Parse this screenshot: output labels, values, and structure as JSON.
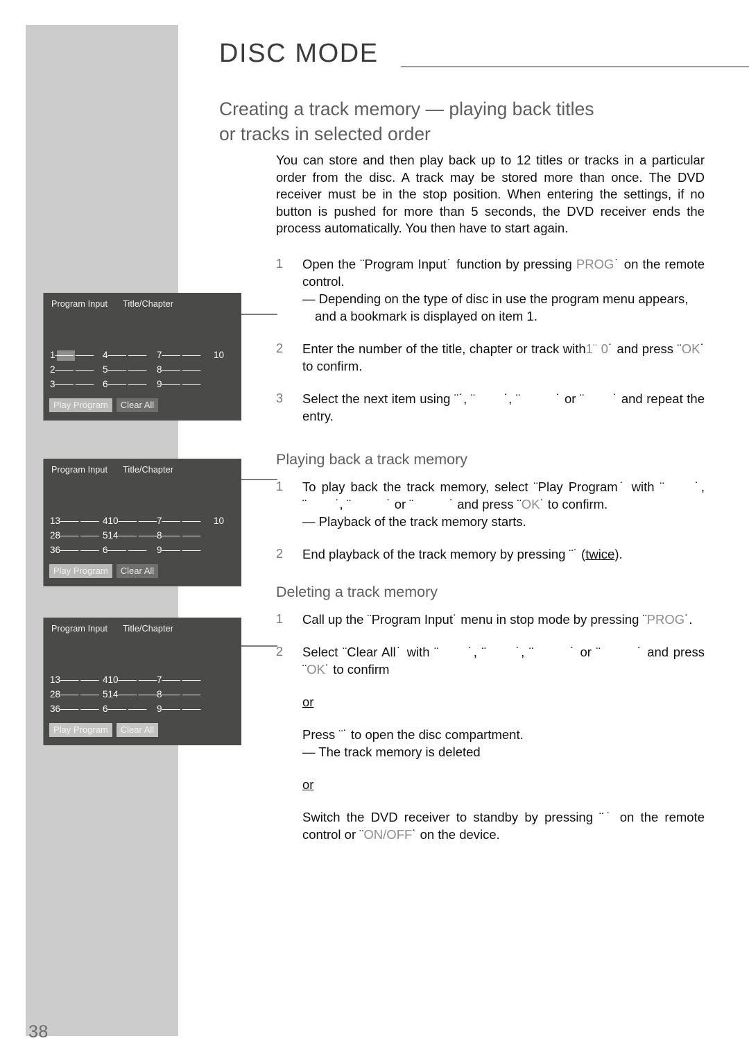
{
  "page": {
    "number": "38",
    "header_title": "DISC MODE",
    "section_title_line1": "Creating a track memory — playing back titles",
    "section_title_line2": "or tracks in selected order"
  },
  "intro": "You can store and then play back up to 12 titles or tracks in a particular order from the disc. A track may be stored more than once. The DVD receiver must be in the stop position. When entering the settings, if no button is pushed for more than 5 seconds, the DVD receiver ends the process automatically. You then have to start again.",
  "steps_create": [
    {
      "num": "1",
      "text_a": "Open the ¨Program Input˙ function by pressing ",
      "key": "PROG",
      "text_b": "˙ on the remote control.",
      "dash": "— Depending on the type of disc in use the program menu appears, and a bookmark is displayed on item 1."
    },
    {
      "num": "2",
      "text_a": "Enter the number of the title, chapter or track with",
      "key": "1¨  0",
      "text_b": "˙ and press ¨",
      "key2": "OK",
      "text_c": "˙ to confirm."
    },
    {
      "num": "3",
      "text_a": "Select the next item using ¨˙, ¨",
      "text_b": "˙, ¨",
      "text_c": "˙ or ¨",
      "text_d": "˙ and repeat the entry."
    }
  ],
  "playback": {
    "heading": "Playing back a track memory",
    "steps": [
      {
        "num": "1",
        "text_a": "To play back the track memory, select ¨Play Program˙ with ¨",
        "text_b": "˙, ¨",
        "text_c": "˙, ¨",
        "text_d": "˙ or ¨",
        "text_e": "˙ and press ¨",
        "key": "OK",
        "text_f": "˙ to confirm.",
        "dash": "— Playback of the track memory starts."
      },
      {
        "num": "2",
        "text_a": "End playback of the track memory by pressing ¨˙ (",
        "underlined": "twice",
        "text_b": ")."
      }
    ]
  },
  "deleting": {
    "heading": "Deleting a track memory",
    "steps": [
      {
        "num": "1",
        "text_a": "Call up the ¨Program Input˙ menu in stop mode by pressing ¨",
        "key": "PROG",
        "text_b": "˙."
      },
      {
        "num": "2",
        "text_a": "Select ¨Clear All˙ with ¨",
        "text_b": "˙, ¨",
        "text_c": "˙, ¨",
        "text_d": "˙ or ¨",
        "text_e": "˙ and press ¨",
        "key": "OK",
        "text_f": "˙ to confirm"
      }
    ],
    "or_1": "or",
    "alt_1_line1": "Press ¨˙ to open the disc compartment.",
    "alt_1_line2": "— The track memory is deleted",
    "or_2": "or",
    "alt_2_a": "Switch the DVD receiver to standby by pressing ¨˙ on the remote control or ¨",
    "alt_2_key": "ON/OFF",
    "alt_2_b": "˙ on the device."
  },
  "osd_screens": [
    {
      "id": "osd-1",
      "head_left": "Program Input",
      "head_right": "Title/Chapter",
      "rows": [
        [
          {
            "idx": "1",
            "val": "",
            "ph": "—— ——",
            "cursor": true
          },
          {
            "idx": "4",
            "val": "",
            "ph": "—— ——"
          },
          {
            "idx": "7",
            "val": "",
            "ph": "—— ——"
          },
          {
            "idx": "10",
            "val": "",
            "ph": ""
          }
        ],
        [
          {
            "idx": "2",
            "val": "",
            "ph": "—— ——"
          },
          {
            "idx": "5",
            "val": "",
            "ph": "—— ——"
          },
          {
            "idx": "8",
            "val": "",
            "ph": "—— ——"
          },
          {
            "idx": "",
            "val": "",
            "ph": ""
          }
        ],
        [
          {
            "idx": "3",
            "val": "",
            "ph": "—— ——"
          },
          {
            "idx": "6",
            "val": "",
            "ph": "—— ——"
          },
          {
            "idx": "9",
            "val": "",
            "ph": "—— ——"
          },
          {
            "idx": "",
            "val": "",
            "ph": ""
          }
        ]
      ],
      "play_label": "Play Program",
      "clear_label": "Clear All",
      "selected": "play"
    },
    {
      "id": "osd-2",
      "head_left": "Program Input",
      "head_right": "Title/Chapter",
      "rows": [
        [
          {
            "idx": "1",
            "val": "3",
            "ph": "—— ——"
          },
          {
            "idx": "4",
            "val": "10",
            "ph": "—— ——"
          },
          {
            "idx": "7",
            "val": "",
            "ph": "—— ——"
          },
          {
            "idx": "10",
            "val": "",
            "ph": ""
          }
        ],
        [
          {
            "idx": "2",
            "val": "8",
            "ph": "—— ——"
          },
          {
            "idx": "5",
            "val": "14",
            "ph": "—— ——"
          },
          {
            "idx": "8",
            "val": "",
            "ph": "—— ——"
          },
          {
            "idx": "",
            "val": "",
            "ph": ""
          }
        ],
        [
          {
            "idx": "3",
            "val": "6",
            "ph": "—— ——"
          },
          {
            "idx": "6",
            "val": "",
            "ph": "—— ——"
          },
          {
            "idx": "9",
            "val": "",
            "ph": "—— ——"
          },
          {
            "idx": "",
            "val": "",
            "ph": ""
          }
        ]
      ],
      "play_label": "Play Program",
      "clear_label": "Clear All",
      "selected": "play"
    },
    {
      "id": "osd-3",
      "head_left": "Program Input",
      "head_right": "Title/Chapter",
      "rows": [
        [
          {
            "idx": "1",
            "val": "3",
            "ph": "—— ——"
          },
          {
            "idx": "4",
            "val": "10",
            "ph": "—— ——"
          },
          {
            "idx": "7",
            "val": "",
            "ph": "—— ——"
          },
          {
            "idx": "",
            "val": "",
            "ph": ""
          }
        ],
        [
          {
            "idx": "2",
            "val": "8",
            "ph": "—— ——"
          },
          {
            "idx": "5",
            "val": "14",
            "ph": "—— ——"
          },
          {
            "idx": "8",
            "val": "",
            "ph": "—— ——"
          },
          {
            "idx": "",
            "val": "",
            "ph": ""
          }
        ],
        [
          {
            "idx": "3",
            "val": "6",
            "ph": "—— ——"
          },
          {
            "idx": "6",
            "val": "",
            "ph": "—— ——"
          },
          {
            "idx": "9",
            "val": "",
            "ph": "—— ——"
          },
          {
            "idx": "",
            "val": "",
            "ph": ""
          }
        ]
      ],
      "play_label": "Play Program",
      "clear_label": "Clear All",
      "selected": "clear"
    }
  ],
  "colors": {
    "band_grey": "#cccccc",
    "osd_bg": "#4a4a48",
    "osd_button": "#6f6f6d",
    "osd_button_selected": "#bcbcba",
    "heading_grey": "#5e5e5e",
    "key_grey": "#8d8d8d"
  }
}
